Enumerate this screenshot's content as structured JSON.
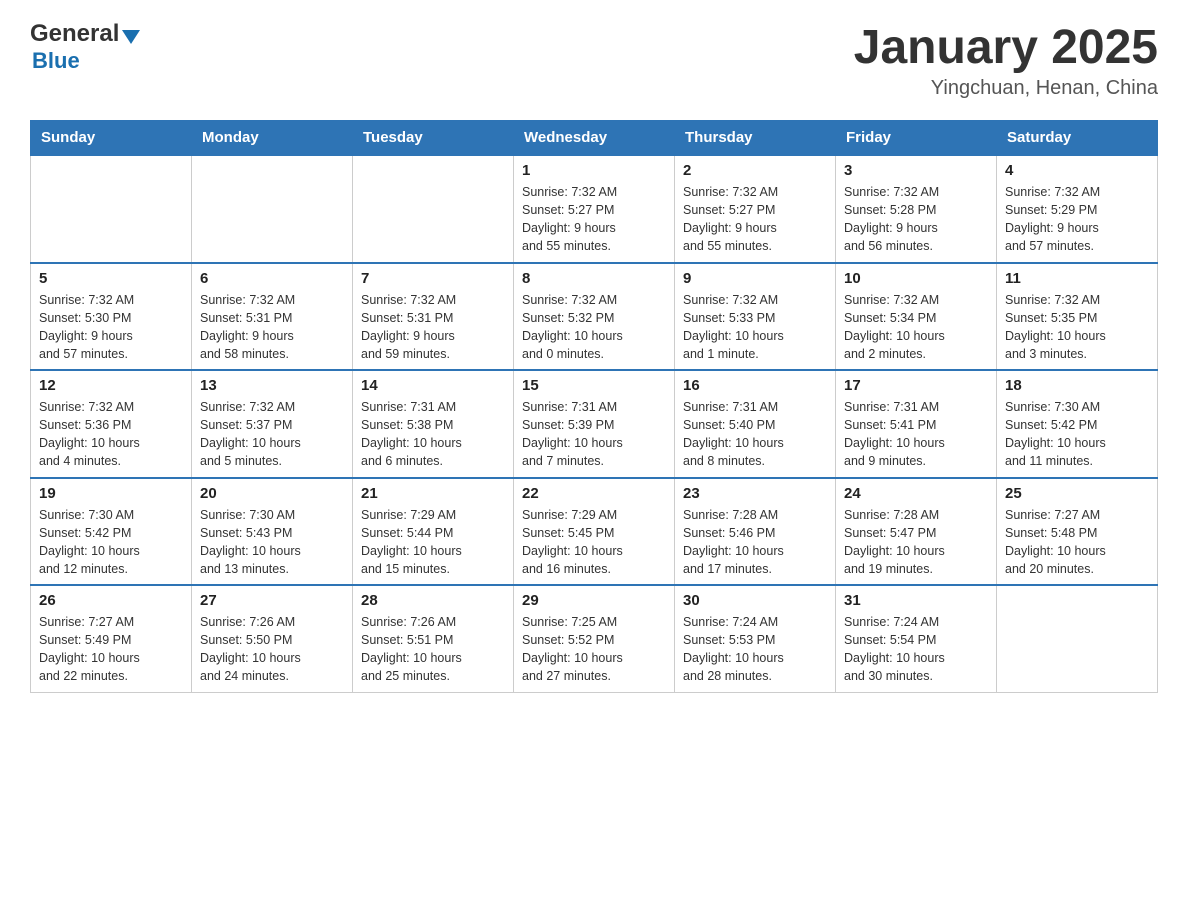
{
  "header": {
    "logo_general": "General",
    "logo_blue": "Blue",
    "month_title": "January 2025",
    "location": "Yingchuan, Henan, China"
  },
  "days_of_week": [
    "Sunday",
    "Monday",
    "Tuesday",
    "Wednesday",
    "Thursday",
    "Friday",
    "Saturday"
  ],
  "weeks": [
    {
      "cells": [
        {
          "day": "",
          "info": ""
        },
        {
          "day": "",
          "info": ""
        },
        {
          "day": "",
          "info": ""
        },
        {
          "day": "1",
          "info": "Sunrise: 7:32 AM\nSunset: 5:27 PM\nDaylight: 9 hours\nand 55 minutes."
        },
        {
          "day": "2",
          "info": "Sunrise: 7:32 AM\nSunset: 5:27 PM\nDaylight: 9 hours\nand 55 minutes."
        },
        {
          "day": "3",
          "info": "Sunrise: 7:32 AM\nSunset: 5:28 PM\nDaylight: 9 hours\nand 56 minutes."
        },
        {
          "day": "4",
          "info": "Sunrise: 7:32 AM\nSunset: 5:29 PM\nDaylight: 9 hours\nand 57 minutes."
        }
      ]
    },
    {
      "cells": [
        {
          "day": "5",
          "info": "Sunrise: 7:32 AM\nSunset: 5:30 PM\nDaylight: 9 hours\nand 57 minutes."
        },
        {
          "day": "6",
          "info": "Sunrise: 7:32 AM\nSunset: 5:31 PM\nDaylight: 9 hours\nand 58 minutes."
        },
        {
          "day": "7",
          "info": "Sunrise: 7:32 AM\nSunset: 5:31 PM\nDaylight: 9 hours\nand 59 minutes."
        },
        {
          "day": "8",
          "info": "Sunrise: 7:32 AM\nSunset: 5:32 PM\nDaylight: 10 hours\nand 0 minutes."
        },
        {
          "day": "9",
          "info": "Sunrise: 7:32 AM\nSunset: 5:33 PM\nDaylight: 10 hours\nand 1 minute."
        },
        {
          "day": "10",
          "info": "Sunrise: 7:32 AM\nSunset: 5:34 PM\nDaylight: 10 hours\nand 2 minutes."
        },
        {
          "day": "11",
          "info": "Sunrise: 7:32 AM\nSunset: 5:35 PM\nDaylight: 10 hours\nand 3 minutes."
        }
      ]
    },
    {
      "cells": [
        {
          "day": "12",
          "info": "Sunrise: 7:32 AM\nSunset: 5:36 PM\nDaylight: 10 hours\nand 4 minutes."
        },
        {
          "day": "13",
          "info": "Sunrise: 7:32 AM\nSunset: 5:37 PM\nDaylight: 10 hours\nand 5 minutes."
        },
        {
          "day": "14",
          "info": "Sunrise: 7:31 AM\nSunset: 5:38 PM\nDaylight: 10 hours\nand 6 minutes."
        },
        {
          "day": "15",
          "info": "Sunrise: 7:31 AM\nSunset: 5:39 PM\nDaylight: 10 hours\nand 7 minutes."
        },
        {
          "day": "16",
          "info": "Sunrise: 7:31 AM\nSunset: 5:40 PM\nDaylight: 10 hours\nand 8 minutes."
        },
        {
          "day": "17",
          "info": "Sunrise: 7:31 AM\nSunset: 5:41 PM\nDaylight: 10 hours\nand 9 minutes."
        },
        {
          "day": "18",
          "info": "Sunrise: 7:30 AM\nSunset: 5:42 PM\nDaylight: 10 hours\nand 11 minutes."
        }
      ]
    },
    {
      "cells": [
        {
          "day": "19",
          "info": "Sunrise: 7:30 AM\nSunset: 5:42 PM\nDaylight: 10 hours\nand 12 minutes."
        },
        {
          "day": "20",
          "info": "Sunrise: 7:30 AM\nSunset: 5:43 PM\nDaylight: 10 hours\nand 13 minutes."
        },
        {
          "day": "21",
          "info": "Sunrise: 7:29 AM\nSunset: 5:44 PM\nDaylight: 10 hours\nand 15 minutes."
        },
        {
          "day": "22",
          "info": "Sunrise: 7:29 AM\nSunset: 5:45 PM\nDaylight: 10 hours\nand 16 minutes."
        },
        {
          "day": "23",
          "info": "Sunrise: 7:28 AM\nSunset: 5:46 PM\nDaylight: 10 hours\nand 17 minutes."
        },
        {
          "day": "24",
          "info": "Sunrise: 7:28 AM\nSunset: 5:47 PM\nDaylight: 10 hours\nand 19 minutes."
        },
        {
          "day": "25",
          "info": "Sunrise: 7:27 AM\nSunset: 5:48 PM\nDaylight: 10 hours\nand 20 minutes."
        }
      ]
    },
    {
      "cells": [
        {
          "day": "26",
          "info": "Sunrise: 7:27 AM\nSunset: 5:49 PM\nDaylight: 10 hours\nand 22 minutes."
        },
        {
          "day": "27",
          "info": "Sunrise: 7:26 AM\nSunset: 5:50 PM\nDaylight: 10 hours\nand 24 minutes."
        },
        {
          "day": "28",
          "info": "Sunrise: 7:26 AM\nSunset: 5:51 PM\nDaylight: 10 hours\nand 25 minutes."
        },
        {
          "day": "29",
          "info": "Sunrise: 7:25 AM\nSunset: 5:52 PM\nDaylight: 10 hours\nand 27 minutes."
        },
        {
          "day": "30",
          "info": "Sunrise: 7:24 AM\nSunset: 5:53 PM\nDaylight: 10 hours\nand 28 minutes."
        },
        {
          "day": "31",
          "info": "Sunrise: 7:24 AM\nSunset: 5:54 PM\nDaylight: 10 hours\nand 30 minutes."
        },
        {
          "day": "",
          "info": ""
        }
      ]
    }
  ]
}
